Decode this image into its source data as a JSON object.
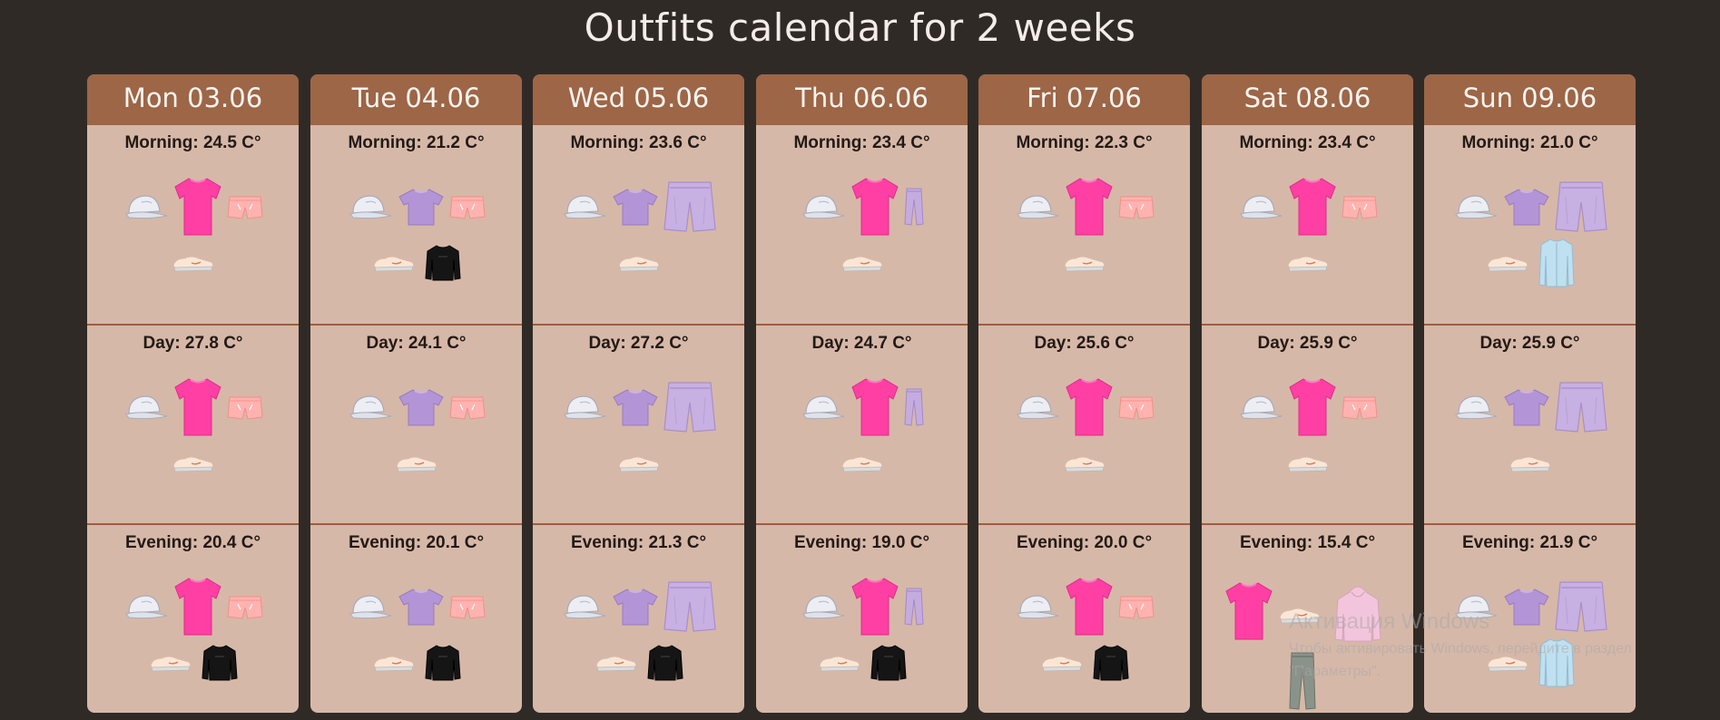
{
  "page": {
    "title": "Outfits calendar for 2 weeks"
  },
  "days": [
    {
      "label": "Mon 03.06",
      "slots": [
        {
          "label": "Morning: 24.5 C°",
          "items": [
            "cap-icon",
            "tshirt-pink-icon",
            "shorts-pink-icon",
            "sneakers-icon"
          ]
        },
        {
          "label": "Day: 27.8 C°",
          "items": [
            "cap-icon",
            "tshirt-pink-icon",
            "shorts-pink-icon",
            "sneakers-icon"
          ]
        },
        {
          "label": "Evening: 20.4 C°",
          "items": [
            "cap-icon",
            "tshirt-pink-icon",
            "shorts-pink-icon",
            "sneakers-icon",
            "sweatshirt-black-icon"
          ]
        }
      ]
    },
    {
      "label": "Tue 04.06",
      "slots": [
        {
          "label": "Morning: 21.2 C°",
          "items": [
            "cap-icon",
            "tshirt-purple-icon",
            "shorts-pink-icon",
            "sneakers-icon",
            "sweatshirt-black-icon"
          ]
        },
        {
          "label": "Day: 24.1 C°",
          "items": [
            "cap-icon",
            "tshirt-purple-icon",
            "shorts-pink-icon",
            "sneakers-icon"
          ]
        },
        {
          "label": "Evening: 20.1 C°",
          "items": [
            "cap-icon",
            "tshirt-purple-icon",
            "shorts-pink-icon",
            "sneakers-icon",
            "sweatshirt-black-icon"
          ]
        }
      ]
    },
    {
      "label": "Wed 05.06",
      "slots": [
        {
          "label": "Morning: 23.6 C°",
          "items": [
            "cap-icon",
            "tshirt-purple-icon",
            "shorts-lavender-icon",
            "sneakers-icon"
          ]
        },
        {
          "label": "Day: 27.2 C°",
          "items": [
            "cap-icon",
            "tshirt-purple-icon",
            "shorts-lavender-icon",
            "sneakers-icon"
          ]
        },
        {
          "label": "Evening: 21.3 C°",
          "items": [
            "cap-icon",
            "tshirt-purple-icon",
            "shorts-lavender-icon",
            "sneakers-icon",
            "sweatshirt-black-icon"
          ]
        }
      ]
    },
    {
      "label": "Thu 06.06",
      "slots": [
        {
          "label": "Morning: 23.4 C°",
          "items": [
            "cap-icon",
            "tshirt-pink-icon",
            "pants-lavender-icon",
            "sneakers-icon"
          ]
        },
        {
          "label": "Day: 24.7 C°",
          "items": [
            "cap-icon",
            "tshirt-pink-icon",
            "pants-lavender-icon",
            "sneakers-icon"
          ]
        },
        {
          "label": "Evening: 19.0 C°",
          "items": [
            "cap-icon",
            "tshirt-pink-icon",
            "pants-lavender-icon",
            "sneakers-icon",
            "sweatshirt-black-icon"
          ]
        }
      ]
    },
    {
      "label": "Fri 07.06",
      "slots": [
        {
          "label": "Morning: 22.3 C°",
          "items": [
            "cap-icon",
            "tshirt-pink-icon",
            "shorts-pink-icon",
            "sneakers-icon"
          ]
        },
        {
          "label": "Day: 25.6 C°",
          "items": [
            "cap-icon",
            "tshirt-pink-icon",
            "shorts-pink-icon",
            "sneakers-icon"
          ]
        },
        {
          "label": "Evening: 20.0 C°",
          "items": [
            "cap-icon",
            "tshirt-pink-icon",
            "shorts-pink-icon",
            "sneakers-icon",
            "sweatshirt-black-icon"
          ]
        }
      ]
    },
    {
      "label": "Sat 08.06",
      "slots": [
        {
          "label": "Morning: 23.4 C°",
          "items": [
            "cap-icon",
            "tshirt-pink-icon",
            "shorts-pink-icon",
            "sneakers-icon"
          ]
        },
        {
          "label": "Day: 25.9 C°",
          "items": [
            "cap-icon",
            "tshirt-pink-icon",
            "shorts-pink-icon",
            "sneakers-icon"
          ]
        },
        {
          "label": "Evening: 15.4 C°",
          "items": [
            "tshirt-pink-icon",
            "sneakers-icon",
            "hoodie-pink-icon",
            "pants-grey-icon"
          ]
        }
      ]
    },
    {
      "label": "Sun 09.06",
      "slots": [
        {
          "label": "Morning: 21.0 C°",
          "items": [
            "cap-icon",
            "tshirt-purple-icon",
            "shorts-lavender-icon",
            "sneakers-icon",
            "jacket-blue-icon"
          ]
        },
        {
          "label": "Day: 25.9 C°",
          "items": [
            "cap-icon",
            "tshirt-purple-icon",
            "shorts-lavender-icon",
            "sneakers-icon"
          ]
        },
        {
          "label": "Evening: 21.9 C°",
          "items": [
            "cap-icon",
            "tshirt-purple-icon",
            "shorts-lavender-icon",
            "sneakers-icon",
            "jacket-blue-icon"
          ]
        }
      ]
    }
  ],
  "watermark": {
    "title": "Активация Windows",
    "line1": "Чтобы активировать Windows, перейдите в раздел",
    "line2": "\"Параметры\"."
  },
  "colors": {
    "background": "#302a27",
    "header": "#9c6647",
    "cell": "#d6b8a8",
    "divider": "#9f5d3f"
  }
}
